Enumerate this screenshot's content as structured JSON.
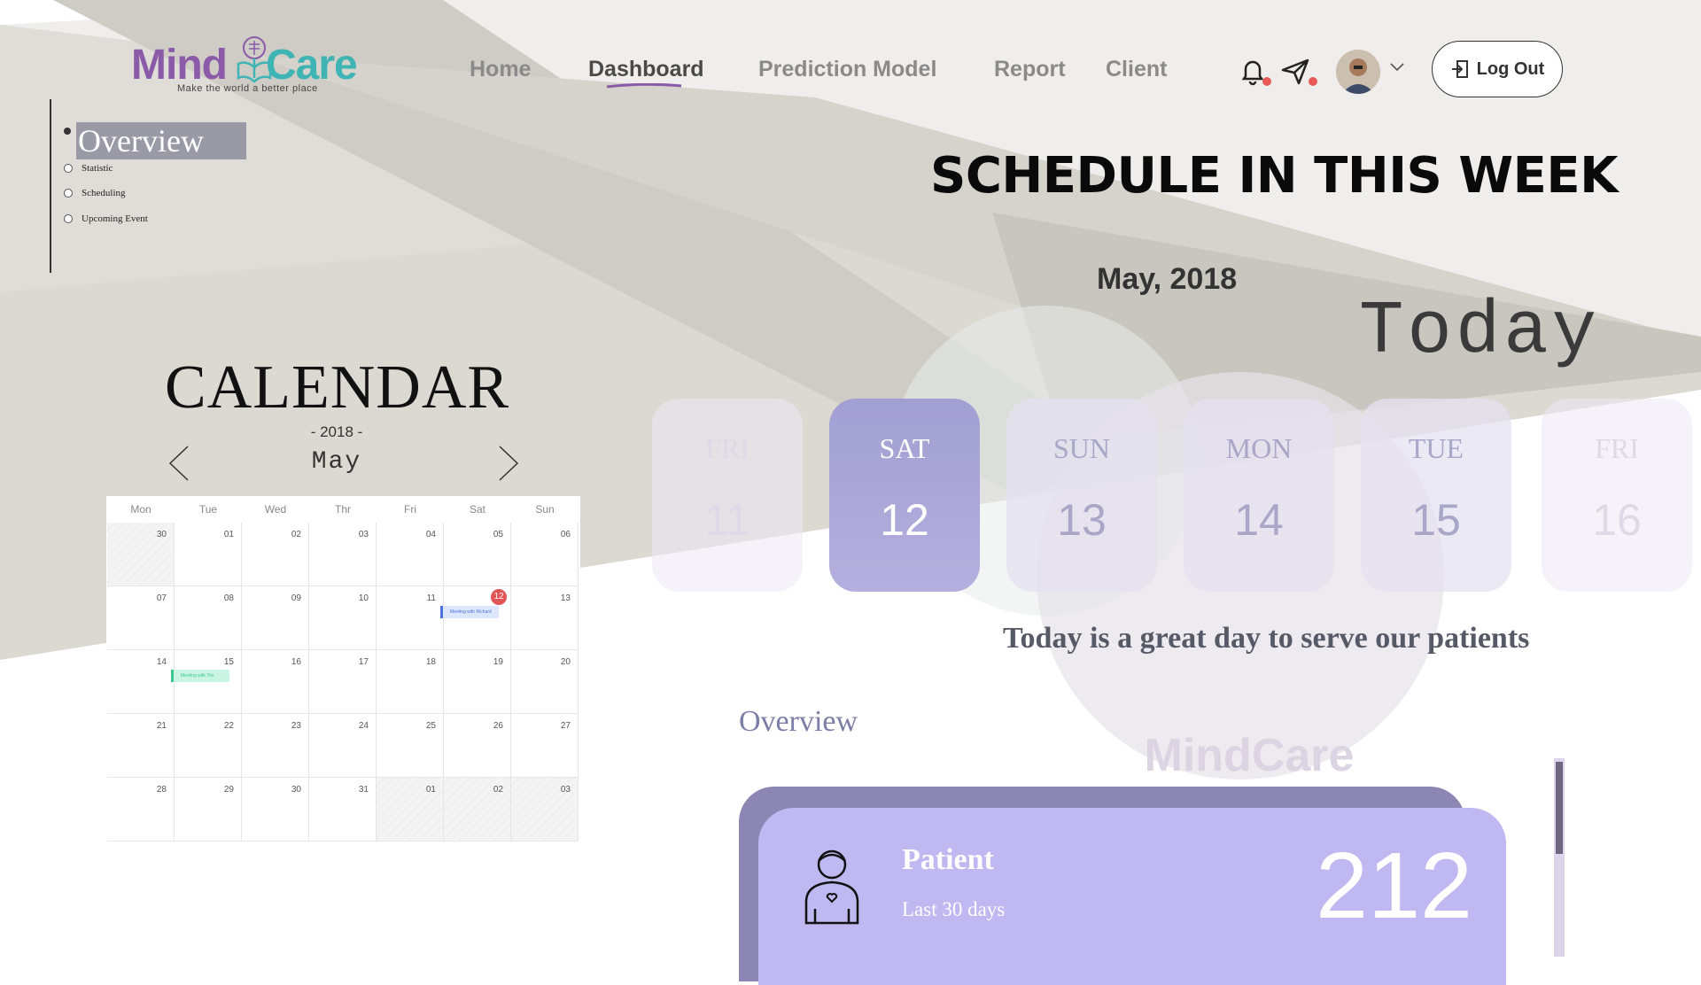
{
  "brand": {
    "name_part1": "Mind",
    "name_part2": "Care",
    "tagline": "Make the world a better place"
  },
  "nav": {
    "items": [
      {
        "label": "Home"
      },
      {
        "label": "Dashboard",
        "active": true
      },
      {
        "label": "Prediction Model"
      },
      {
        "label": "Report"
      },
      {
        "label": "Client"
      }
    ]
  },
  "header": {
    "logout_label": "Log Out",
    "icons": [
      "bell-icon",
      "send-icon",
      "chevron-down-icon",
      "logout-icon"
    ]
  },
  "outline": {
    "title": "Overview",
    "items": [
      {
        "label": "Statistic"
      },
      {
        "label": "Scheduling"
      },
      {
        "label": "Upcoming Event"
      }
    ]
  },
  "calendar": {
    "title": "CALENDAR",
    "year": "- 2018 -",
    "month": "May",
    "weekdays": [
      "Mon",
      "Tue",
      "Wed",
      "Thr",
      "Fri",
      "Sat",
      "Sun"
    ],
    "weeks": [
      [
        "30",
        "01",
        "02",
        "03",
        "04",
        "05",
        "06"
      ],
      [
        "07",
        "08",
        "09",
        "10",
        "11",
        "12",
        "13"
      ],
      [
        "14",
        "15",
        "16",
        "17",
        "18",
        "19",
        "20"
      ],
      [
        "21",
        "22",
        "23",
        "24",
        "25",
        "26",
        "27"
      ],
      [
        "28",
        "29",
        "30",
        "31",
        "01",
        "02",
        "03"
      ]
    ],
    "today": "12",
    "events": [
      {
        "label": "Meeting with Richard",
        "color": "#dde7fb",
        "bar": "#4a72d8"
      },
      {
        "label": "Meeting with Tim",
        "color": "#c9f5e2",
        "bar": "#3cc890"
      }
    ]
  },
  "schedule": {
    "title": "SCHEDULE IN THIS WEEK",
    "month": "May, 2018",
    "today_label": "Today",
    "days": [
      {
        "name": "FRI",
        "date": "11"
      },
      {
        "name": "SAT",
        "date": "12",
        "selected": true
      },
      {
        "name": "SUN",
        "date": "13"
      },
      {
        "name": "MON",
        "date": "14"
      },
      {
        "name": "TUE",
        "date": "15"
      },
      {
        "name": "FRI",
        "date": "16"
      }
    ],
    "tagline": "Today is a great day to serve our patients"
  },
  "overview": {
    "heading": "Overview",
    "card": {
      "title": "Patient",
      "subtitle": "Last 30 days",
      "value": "212"
    }
  },
  "colors": {
    "accent": "#8b5aa8",
    "teal": "#3fb4b4",
    "selected_day": "#a9a6d6",
    "card": "#c0b8f0",
    "card_back": "#8b86b4"
  }
}
